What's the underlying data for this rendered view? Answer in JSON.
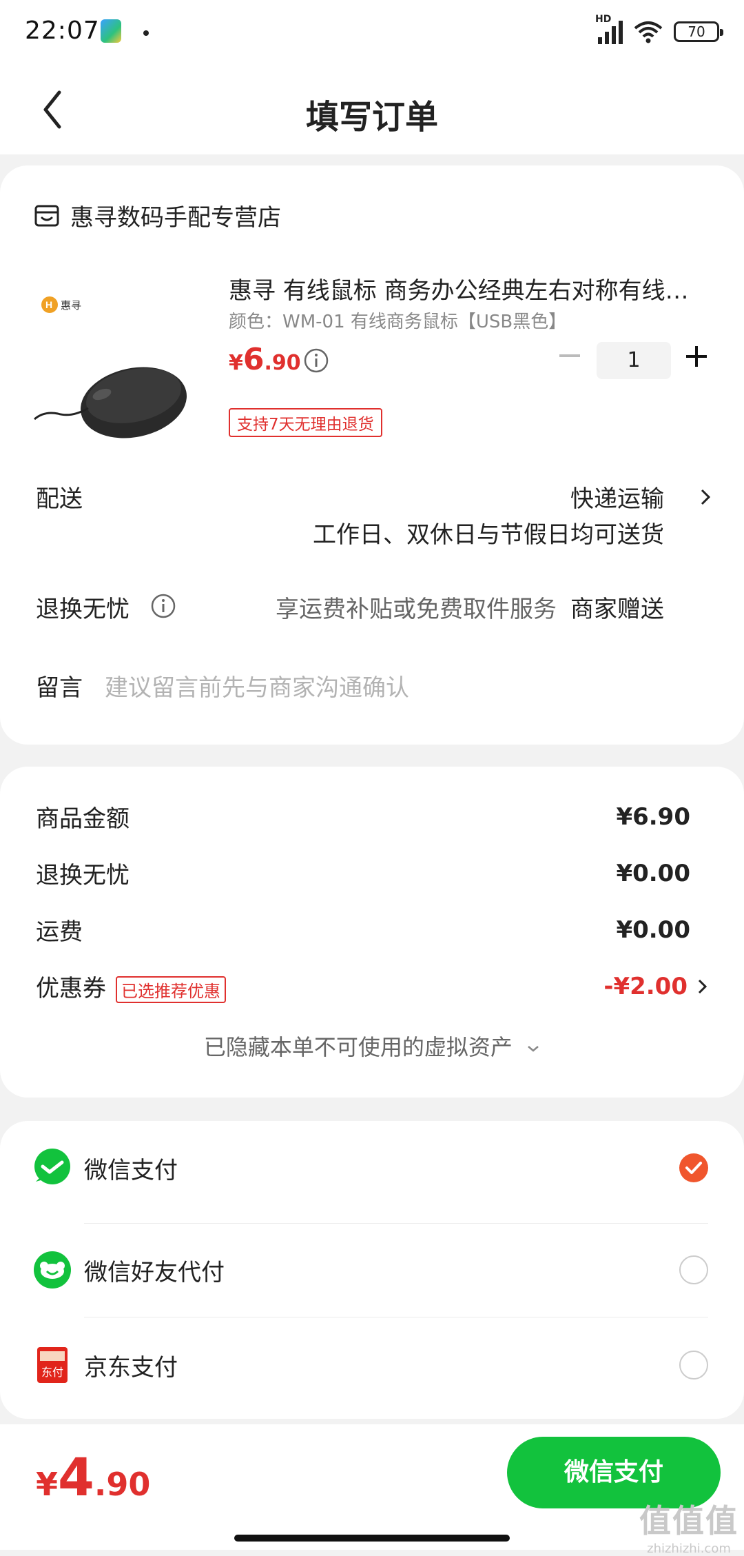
{
  "status_bar": {
    "time": "22:07",
    "battery": "70",
    "network": "HD"
  },
  "header": {
    "title": "填写订单"
  },
  "store": {
    "name": "惠寻数码手配专营店"
  },
  "product": {
    "brand_logo_text": "惠寻",
    "title": "惠寻 有线鼠标 商务办公经典左右对称有线鼠标",
    "spec": "颜色：WM-01 有线商务鼠标【USB黑色】",
    "price_currency": "¥",
    "price_int": "6",
    "price_dec": ".90",
    "quantity": "1",
    "return_tag": "支持7天无理由退货"
  },
  "delivery": {
    "label": "配送",
    "method": "快递运输",
    "note": "工作日、双休日与节假日均可送货"
  },
  "worry_free": {
    "label": "退换无忧",
    "desc": "享运费补贴或免费取件服务",
    "value": "商家赠送"
  },
  "message": {
    "label": "留言",
    "placeholder": "建议留言前先与商家沟通确认"
  },
  "price_summary": {
    "items": [
      {
        "label": "商品金额",
        "amount": "¥6.90"
      },
      {
        "label": "退换无忧",
        "amount": "¥0.00"
      },
      {
        "label": "运费",
        "amount": "¥0.00"
      }
    ],
    "coupon": {
      "label": "优惠券",
      "tag": "已选推荐优惠",
      "amount": "-¥2.00"
    },
    "hidden_assets": "已隐藏本单不可使用的虚拟资产"
  },
  "payment": {
    "methods": [
      {
        "label": "微信支付",
        "selected": true
      },
      {
        "label": "微信好友代付",
        "selected": false
      },
      {
        "label": "京东支付",
        "selected": false
      }
    ],
    "jd_icon_text": "东付"
  },
  "bottom": {
    "total_currency": "¥",
    "total_int": "4",
    "total_dec": ".90",
    "submit_label": "微信支付"
  },
  "watermark": {
    "mark": "值值值",
    "domain": "zhizhizhi.com"
  },
  "colors": {
    "accent_red": "#e0302e",
    "wechat_green": "#12c23d",
    "check_orange": "#f0562d"
  }
}
